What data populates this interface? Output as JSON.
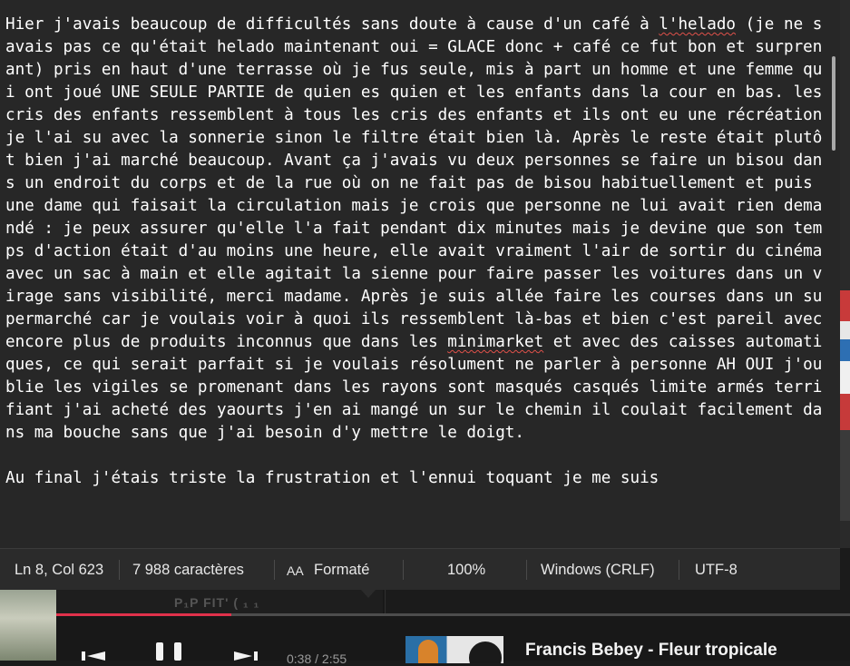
{
  "editor": {
    "text_before_1": "Hier j'avais beaucoup de difficultés sans doute à cause d'un café à ",
    "spell_1": "l'helado",
    "text_after_1": " (je ne savais pas ce qu'était helado maintenant oui = GLACE donc + café ce fut bon et surprenant) pris en haut d'une terrasse où je fus seule, mis à part un homme et une femme qui ont joué UNE SEULE PARTIE de quien es quien et les enfants dans la cour en bas. les cris des enfants ressemblent à tous les cris des enfants et ils ont eu une récréation je l'ai su avec la sonnerie sinon le filtre était bien là. Après le reste était plutôt bien j'ai marché beaucoup. Avant ça j'avais vu deux personnes se faire un bisou dans un endroit du corps et de la rue où on ne fait pas de bisou habituellement et puis une dame qui faisait la circulation mais je crois que personne ne lui avait rien demandé : je peux assurer qu'elle l'a fait pendant dix minutes mais je devine que son temps d'action était d'au moins une heure, elle avait vraiment l'air de sortir du cinéma avec un sac à main et elle agitait la sienne pour faire passer les voitures dans un virage sans visibilité, merci madame. Après je suis allée faire les courses dans un supermarché car je voulais voir à quoi ils ressemblent là-bas et bien c'est pareil avec encore plus de produits inconnus que dans les ",
    "spell_2": "minimarket",
    "text_after_2": " et avec des caisses automatiques, ce qui serait parfait si je voulais résolument ne parler à personne AH OUI j'oublie les vigiles se promenant dans les rayons sont masqués casqués limite armés terrifiant j'ai acheté des yaourts j'en ai mangé un sur le chemin il coulait facilement dans ma bouche sans que j'ai besoin d'y mettre le doigt.\n\nAu final j'étais triste la frustration et l'ennui toquant je me suis"
  },
  "status_bar": {
    "position": "Ln 8, Col 623",
    "char_count": "7 988 caractères",
    "format_icon": "AA",
    "format_label": "Formaté",
    "zoom": "100%",
    "line_ending": "Windows (CRLF)",
    "encoding": "UTF-8"
  },
  "player": {
    "ghost_text": "P₁P FIT' ( ₁ ₁",
    "time": "0:38 / 2:55",
    "track_title": "Francis Bebey - Fleur tropicale",
    "progress": 0.22,
    "accent_color": "#e0314b"
  }
}
